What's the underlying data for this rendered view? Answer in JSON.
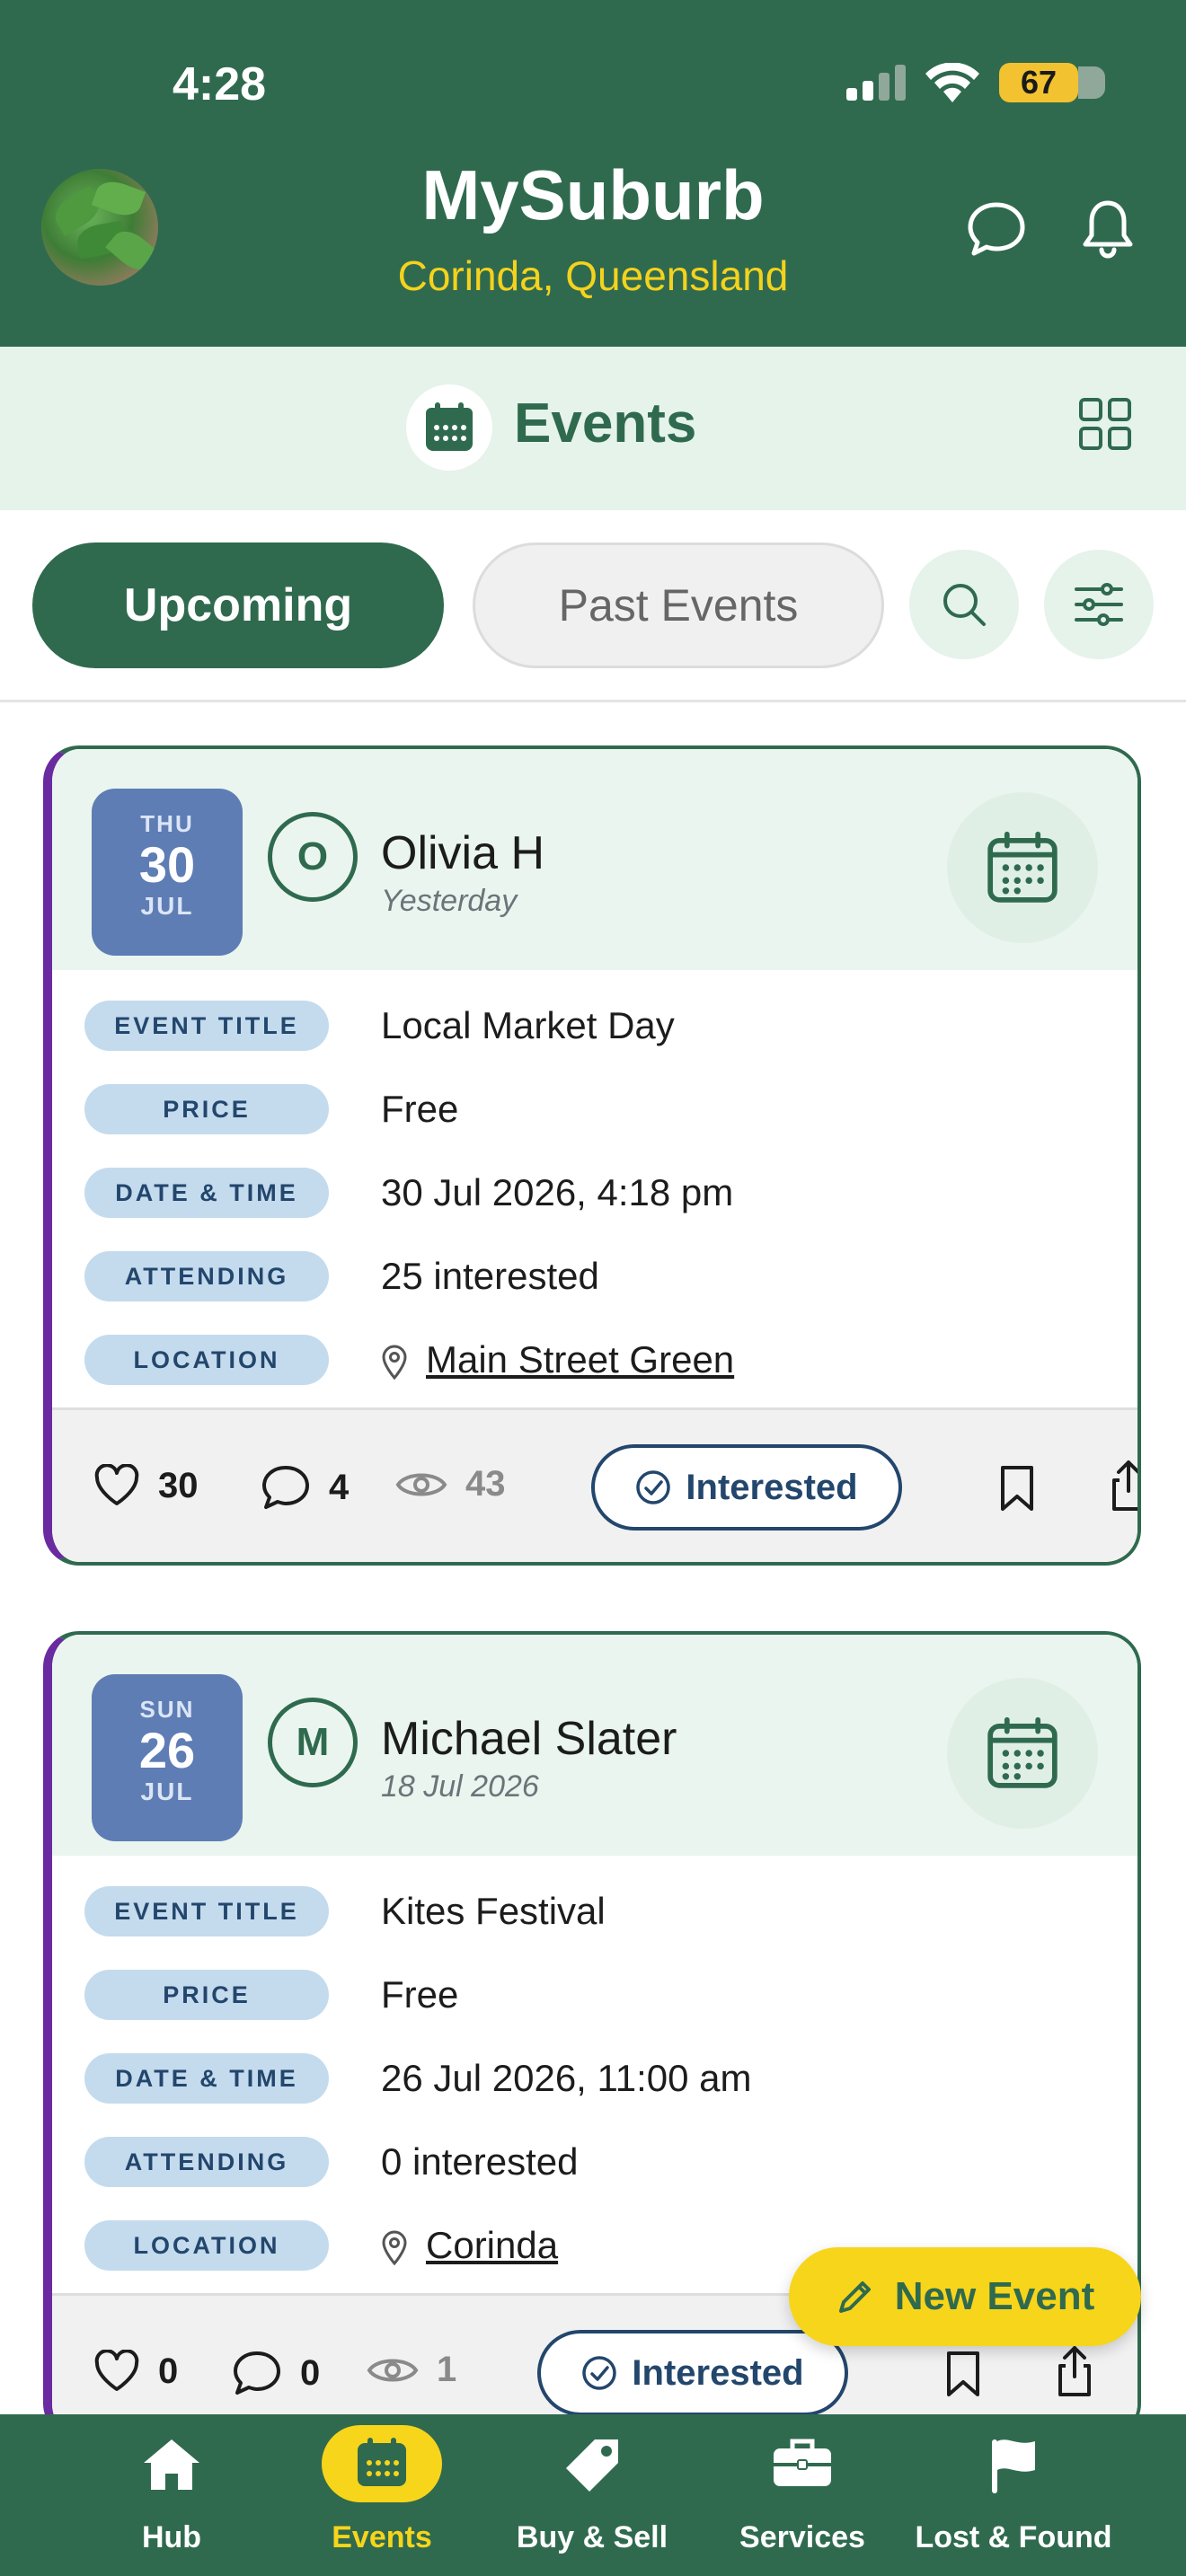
{
  "status": {
    "time": "4:28",
    "battery": "67"
  },
  "header": {
    "title": "MySuburb",
    "subtitle": "Corinda, Queensland"
  },
  "section": {
    "title": "Events"
  },
  "tabs": {
    "upcoming": "Upcoming",
    "past": "Past Events"
  },
  "labels": {
    "event_title": "EVENT TITLE",
    "price": "PRICE",
    "date_time": "DATE & TIME",
    "attending": "ATTENDING",
    "location": "LOCATION"
  },
  "events": [
    {
      "dow": "THU",
      "day": "30",
      "month": "JUL",
      "initial": "O",
      "author": "Olivia H",
      "posted": "Yesterday",
      "title": "Local Market Day",
      "price": "Free",
      "datetime": "30 Jul 2026, 4:18 pm",
      "attending": "25 interested",
      "location": "Main Street Green",
      "likes": "30",
      "comments": "4",
      "views": "43",
      "interested_label": "Interested"
    },
    {
      "dow": "SUN",
      "day": "26",
      "month": "JUL",
      "initial": "M",
      "author": "Michael Slater",
      "posted": "18 Jul 2026",
      "title": "Kites Festival",
      "price": "Free",
      "datetime": "26 Jul 2026, 11:00 am",
      "attending": "0 interested",
      "location": "Corinda",
      "likes": "0",
      "comments": "0",
      "views": "1",
      "interested_label": "Interested"
    }
  ],
  "fab": {
    "label": "New Event"
  },
  "nav": [
    {
      "label": "Hub",
      "icon": "home-icon"
    },
    {
      "label": "Events",
      "icon": "calendar-icon",
      "active": true
    },
    {
      "label": "Buy & Sell",
      "icon": "tag-icon"
    },
    {
      "label": "Services",
      "icon": "briefcase-icon"
    },
    {
      "label": "Lost & Found",
      "icon": "flag-icon"
    }
  ],
  "colors": {
    "primary": "#2f6a4f",
    "accent": "#f7d51a",
    "badge": "#5e7db5",
    "pill": "#c4dbee"
  }
}
